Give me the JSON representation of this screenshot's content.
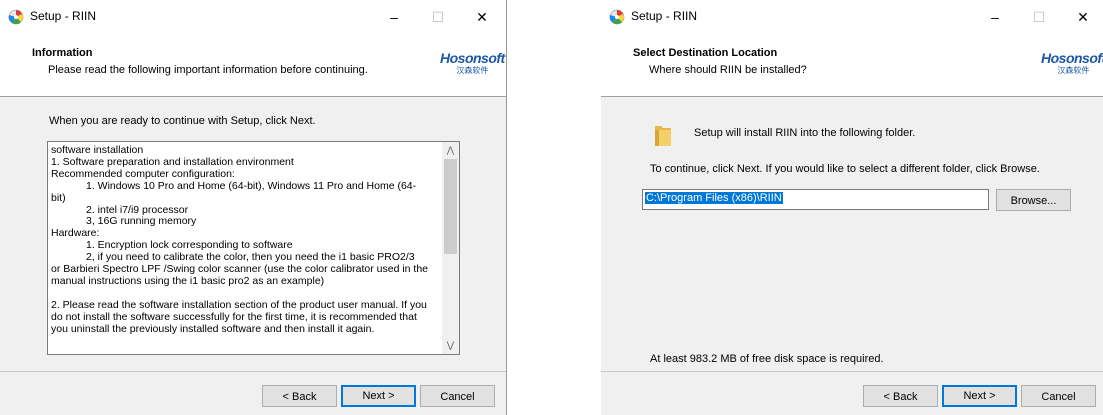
{
  "window_left": {
    "title": "Setup - RIIN",
    "controls": {
      "minimize": "–",
      "maximize": "☐",
      "close": "✕"
    },
    "header": {
      "title": "Information",
      "subtitle": "Please read the following important information before continuing.",
      "logo_en": "Hosonsoft",
      "logo_cn": "汉森软件"
    },
    "lead": "When you are ready to continue with Setup, click Next.",
    "memo_lines": [
      "software installation",
      "1. Software preparation and installation environment",
      "Recommended computer configuration:",
      "            1. Windows 10 Pro and Home (64-bit), Windows 11 Pro and Home (64-",
      "bit)",
      "            2. intel i7/i9 processor",
      "            3, 16G running memory",
      "Hardware:",
      "            1. Encryption lock corresponding to software",
      "            2, if you need to calibrate the color, then you need the i1 basic PRO2/3",
      "or Barbieri Spectro LPF /Swing color scanner (use the color calibrator used in the",
      "manual instructions using the i1 basic pro2 as an example)",
      "",
      "2. Please read the software installation section of the product user manual. If you",
      "do not install the software successfully for the first time, it is recommended that",
      "you uninstall the previously installed software and then install it again."
    ],
    "buttons": {
      "back": "< Back",
      "next": "Next >",
      "cancel": "Cancel"
    }
  },
  "window_right": {
    "title": "Setup - RIIN",
    "controls": {
      "minimize": "–",
      "maximize": "☐",
      "close": "✕"
    },
    "header": {
      "title": "Select Destination Location",
      "subtitle": "Where should RIIN be installed?",
      "logo_en": "Hosonsoft",
      "logo_cn": "汉森软件"
    },
    "install_note": "Setup will install RIIN into the following folder.",
    "continue_note": "To continue, click Next. If you would like to select a different folder, click Browse.",
    "path_value": "C:\\Program Files (x86)\\RIIN",
    "browse_label": "Browse...",
    "disk_space": "At least 983.2 MB of free disk space is required.",
    "buttons": {
      "back": "< Back",
      "next": "Next >",
      "cancel": "Cancel"
    }
  }
}
